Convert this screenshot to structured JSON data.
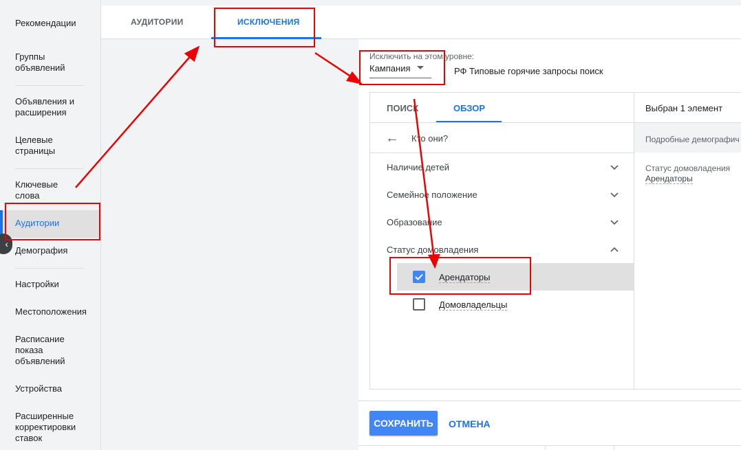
{
  "sidebar": {
    "items": [
      {
        "label": "Рекомендации"
      },
      {
        "label": "Группы объявлений"
      },
      {
        "label": "Объявления и расширения"
      },
      {
        "label": "Целевые страницы"
      },
      {
        "label": "Ключевые слова"
      },
      {
        "label": "Аудитории"
      },
      {
        "label": "Демография"
      },
      {
        "label": "Настройки"
      },
      {
        "label": "Местоположения"
      },
      {
        "label": "Расписание показа объявлений"
      },
      {
        "label": "Устройства"
      },
      {
        "label": "Расширенные корректировки ставок"
      }
    ],
    "active_item": "Аудитории"
  },
  "tabs": [
    {
      "label": "АУДИТОРИИ"
    },
    {
      "label": "ИСКЛЮЧЕНИЯ"
    }
  ],
  "level": {
    "label": "Исключить на этом уровне:",
    "selected": "Кампания",
    "campaign_name": "РФ Типовые горячие запросы поиск"
  },
  "picker": {
    "tabs": [
      {
        "label": "ПОИСК"
      },
      {
        "label": "ОБЗОР"
      }
    ],
    "breadcrumb": "Кто они?",
    "categories": [
      {
        "label": "Наличие детей",
        "expanded": false
      },
      {
        "label": "Семейное положение",
        "expanded": false
      },
      {
        "label": "Образование",
        "expanded": false
      },
      {
        "label": "Статус домовладения",
        "expanded": true
      }
    ],
    "options": [
      {
        "label": "Арендаторы",
        "checked": true
      },
      {
        "label": "Домовладельцы",
        "checked": false
      }
    ]
  },
  "selected_panel": {
    "header": "Выбран 1 элемент",
    "subheader": "Подробные демографич",
    "group": "Статус домовладения",
    "item": "Арендаторы"
  },
  "actions": {
    "save": "СОХРАНИТЬ",
    "cancel": "ОТМЕНА"
  },
  "colors": {
    "accent": "#1a73e8",
    "annotation": "#ee0000"
  }
}
